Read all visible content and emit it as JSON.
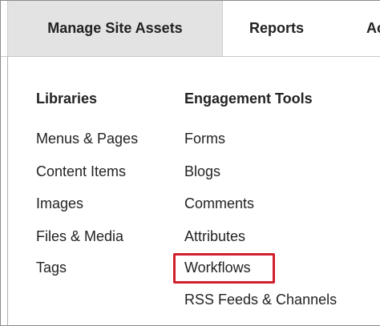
{
  "nav": {
    "tabs": [
      {
        "label": "Manage Site Assets",
        "active": true
      },
      {
        "label": "Reports",
        "active": false
      },
      {
        "label": "Ac",
        "active": false
      }
    ]
  },
  "menu": {
    "libraries": {
      "heading": "Libraries",
      "items": [
        "Menus & Pages",
        "Content Items",
        "Images",
        "Files & Media",
        "Tags"
      ]
    },
    "engagement_tools": {
      "heading": "Engagement Tools",
      "items": [
        "Forms",
        "Blogs",
        "Comments",
        "Attributes",
        "Workflows",
        "RSS Feeds & Channels"
      ]
    }
  },
  "highlight": {
    "target": "Workflows",
    "color": "#d11f2e"
  },
  "colors": {
    "active_tab_bg": "#e3e3e3",
    "text": "#222222"
  }
}
